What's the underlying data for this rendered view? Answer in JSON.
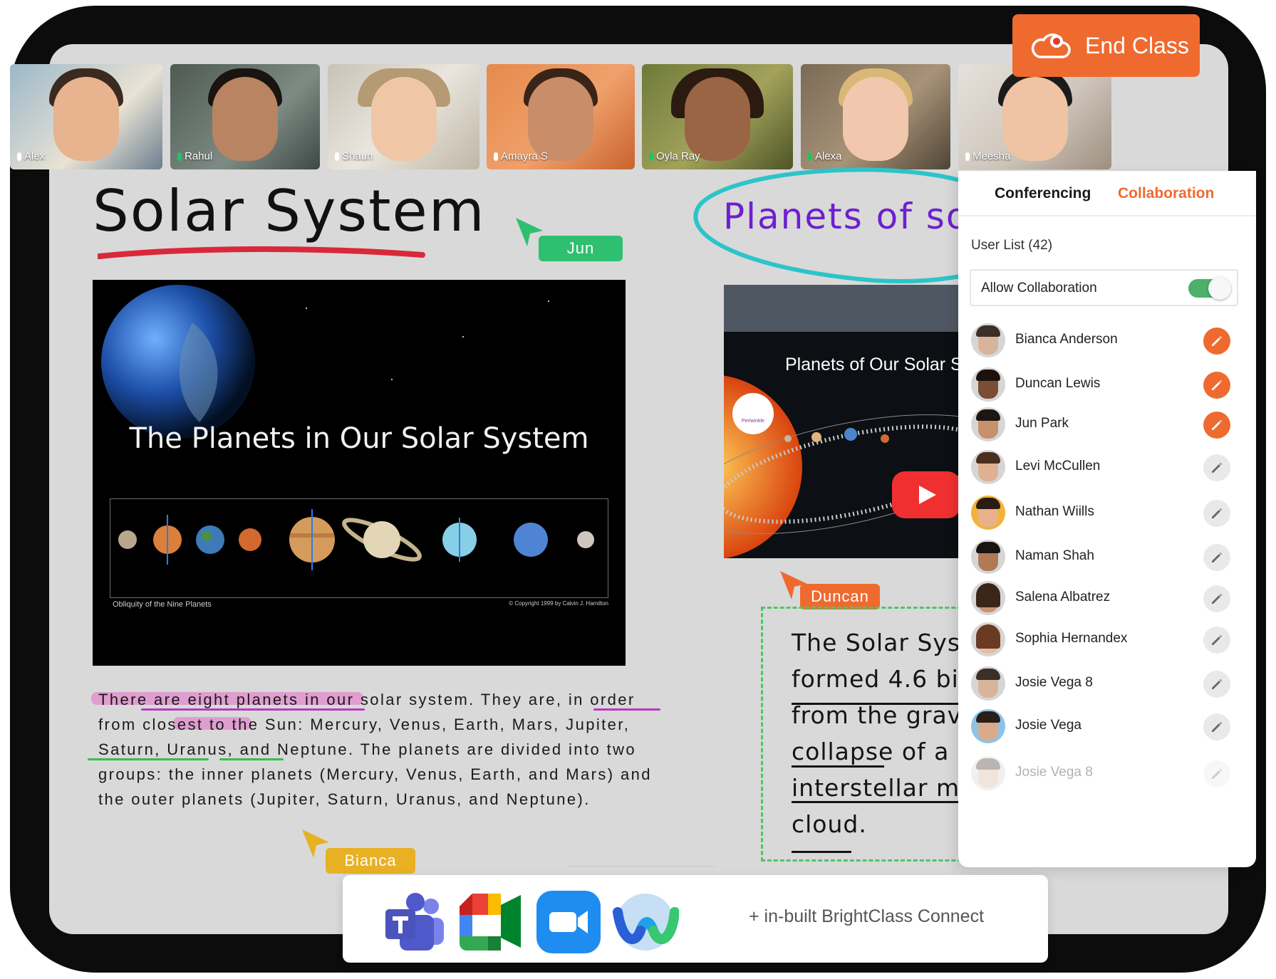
{
  "end_class": {
    "label": "End Class",
    "icon": "cloud-record-icon"
  },
  "participants": [
    {
      "name": "Alex",
      "mic": "muted"
    },
    {
      "name": "Rahul",
      "mic": "active"
    },
    {
      "name": "Shaun",
      "mic": "muted"
    },
    {
      "name": "Amayra S",
      "mic": "muted"
    },
    {
      "name": "Oyla Ray",
      "mic": "active"
    },
    {
      "name": "Alexa",
      "mic": "active"
    },
    {
      "name": "Meesha",
      "mic": "muted"
    }
  ],
  "whiteboard": {
    "title": "Solar System",
    "planets_heading": "Planets of so",
    "slide": {
      "title": "The Planets in Our Solar System",
      "caption": "Obliquity of the Nine Planets",
      "copyright": "© Copyright 1999 by Calvin J. Hamilton",
      "planet_labels": [
        "Mercury",
        "Venus",
        "Earth",
        "Mars",
        "Jupiter",
        "Saturn",
        "Uranus",
        "Neptune",
        "Pluto"
      ]
    },
    "paragraph": "There are eight planets in our solar system. They are, in order from closest to the Sun: Mercury, Venus, Earth, Mars, Jupiter, Saturn, Uranus, and Neptune. The planets are divided into two groups: the inner planets (Mercury, Venus, Earth, and Mars) and the outer planets (Jupiter, Saturn, Uranus, and Neptune).",
    "paragraph_lines": [
      "There are eight planets in our solar system. They are, in order",
      "from closest to the Sun: Mercury, Venus, Earth, Mars, Jupiter,",
      "Saturn, Uranus, and Neptune. The planets are divided into two",
      "groups: the inner planets (Mercury, Venus, Earth, and Mars) and",
      "the outer planets (Jupiter, Saturn, Uranus, and Neptune)."
    ],
    "video": {
      "title": "Planets of Our Solar S",
      "channel": "Periwinkle",
      "orbit_labels": [
        "Mercury",
        "Venus",
        "Earth",
        "Mars",
        "Jupiter"
      ]
    },
    "note_lines": [
      "The Solar Sys",
      "formed 4.6 bil",
      "from the grav",
      "collapse of a g",
      "interstellar m",
      "cloud."
    ],
    "cursors": [
      {
        "name": "Jun",
        "color": "#2fbf71"
      },
      {
        "name": "Duncan",
        "color": "#ef6a2f"
      },
      {
        "name": "Bianca",
        "color": "#e8b124"
      }
    ]
  },
  "panel": {
    "tabs": {
      "conferencing": "Conferencing",
      "collaboration": "Collaboration"
    },
    "active_tab": "Collaboration",
    "user_list_label": "User List (42)",
    "allow_collaboration": {
      "label": "Allow Collaboration",
      "enabled": true
    },
    "users": [
      {
        "name": "Bianca Anderson",
        "can_edit": true
      },
      {
        "name": "Duncan Lewis",
        "can_edit": true
      },
      {
        "name": "Jun Park",
        "can_edit": true
      },
      {
        "name": "Levi McCullen",
        "can_edit": false
      },
      {
        "name": "Nathan Wiills",
        "can_edit": false
      },
      {
        "name": "Naman Shah",
        "can_edit": false
      },
      {
        "name": "Salena Albatrez",
        "can_edit": false
      },
      {
        "name": "Sophia Hernandex",
        "can_edit": false
      },
      {
        "name": "Josie Vega 8",
        "can_edit": false
      },
      {
        "name": "Josie Vega",
        "can_edit": false
      },
      {
        "name": "Josie Vega 8",
        "can_edit": false,
        "faded": true
      }
    ]
  },
  "integrations": {
    "apps": [
      "Microsoft Teams",
      "Google Meet",
      "Zoom",
      "Webex"
    ],
    "connect_label": "+ in-built BrightClass Connect"
  },
  "colors": {
    "accent": "#ef6a2f",
    "collab_green": "#4caf6a",
    "panel_bg": "#ffffff"
  }
}
